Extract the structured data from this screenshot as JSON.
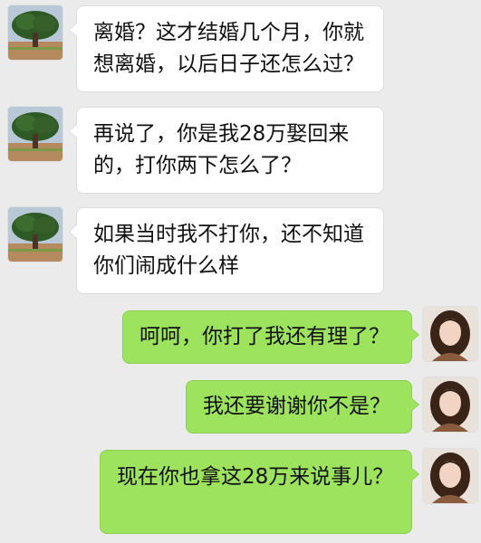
{
  "chat": {
    "messages": [
      {
        "sender": "other",
        "text": "离婚？这才结婚几个月，你就想离婚，以后日子还怎么过？",
        "avatar": "tree-avatar-icon"
      },
      {
        "sender": "other",
        "text": "再说了，你是我28万娶回来的，打你两下怎么了？",
        "avatar": "tree-avatar-icon"
      },
      {
        "sender": "other",
        "text": "如果当时我不打你，还不知道你们闹成什么样",
        "avatar": "tree-avatar-icon"
      },
      {
        "sender": "self",
        "text": "呵呵，你打了我还有理了？",
        "avatar": "woman-avatar-icon"
      },
      {
        "sender": "self",
        "text": "我还要谢谢你不是？",
        "avatar": "woman-avatar-icon"
      },
      {
        "sender": "self",
        "text": "现在你也拿这28万来说事儿？",
        "avatar": "woman-avatar-icon"
      }
    ]
  },
  "colors": {
    "background": "#ebebeb",
    "bubble_other": "#ffffff",
    "bubble_self": "#9de35e"
  }
}
